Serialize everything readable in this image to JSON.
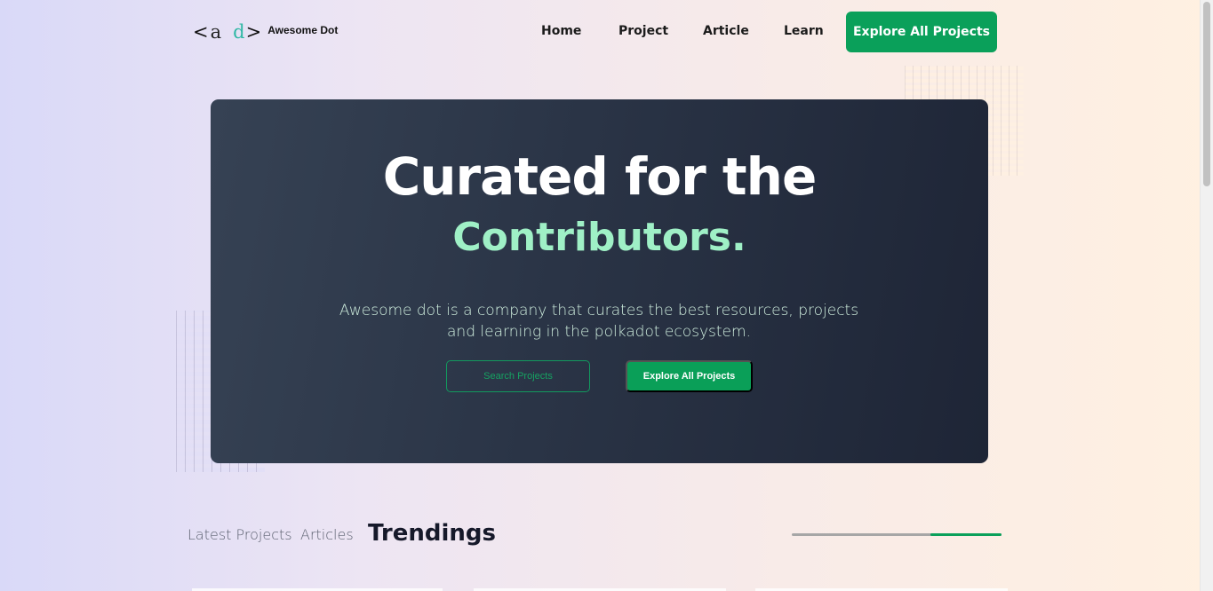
{
  "logo": {
    "lt": "<",
    "a": "a",
    "d": "d",
    "gt": ">",
    "name": "Awesome Dot"
  },
  "nav": {
    "links": [
      "Home",
      "Project",
      "Article",
      "Learn"
    ],
    "cta": "Explore All Projects"
  },
  "hero": {
    "title": "Curated for the",
    "accent": "Contributors.",
    "description": "Awesome dot is a company that curates the best resources, projects and learning in the polkadot ecosystem.",
    "search_button": "Search Projects",
    "explore_button": "Explore All Projects"
  },
  "tabs": {
    "items": [
      "Latest Projects",
      "Articles",
      "Trendings"
    ],
    "active": "Trendings"
  },
  "slider_progress": {
    "start": 0.66,
    "end": 1.0
  },
  "colors": {
    "accent_green": "#0aa05a",
    "accent_mint": "#9ff0c6",
    "hero_bg": "#2a3446"
  }
}
